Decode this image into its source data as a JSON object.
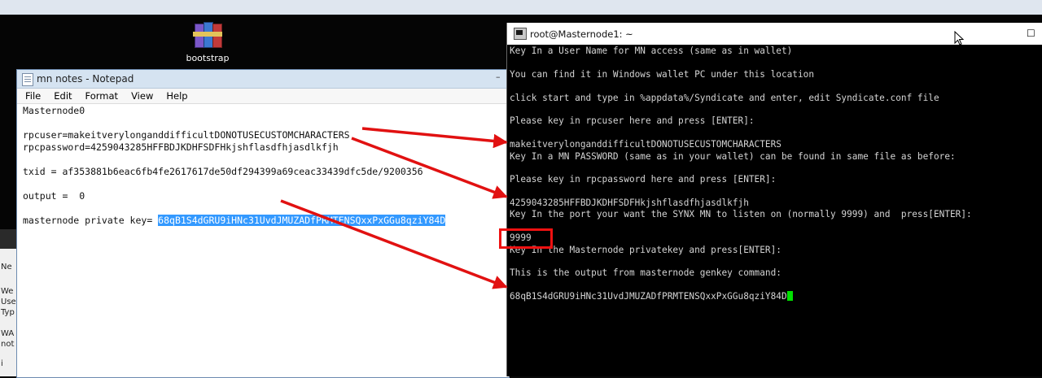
{
  "desktop": {
    "icon_label": "bootstrap"
  },
  "bg_window": {
    "lines": [
      "Ne",
      "We",
      "Use",
      "Typ",
      "WA",
      "not",
      "i"
    ]
  },
  "notepad": {
    "title": "mn notes - Notepad",
    "minimize_symbol": "–",
    "menu": [
      "File",
      "Edit",
      "Format",
      "View",
      "Help"
    ],
    "lines": {
      "masternode": "Masternode0",
      "rpcuser": "rpcuser=makeitverylonganddifficultDONOTUSECUSTOMCHARACTERS",
      "rpcpassword": "rpcpassword=4259043285HFFBDJKDHFSDFHkjshflasdfhjasdlkfjh",
      "txid": "txid = af353881b6eac6fb4fe2617617de50df294399a69ceac33439dfc5de/9200356",
      "output": "output =  0",
      "privkey_label": "masternode private key= ",
      "privkey_value": "68qB1S4dGRU9iHNc31UvdJMUZADfPRMTENSQxxPxGGu8qziY84D"
    }
  },
  "putty": {
    "title": "root@Masternode1: ~",
    "max_symbol": "☐",
    "lines": [
      "Key In a User Name for MN access (same as in wallet)",
      "",
      "You can find it in Windows wallet PC under this location",
      "",
      "click start and type in %appdata%/Syndicate and enter, edit Syndicate.conf file",
      "",
      "Please key in rpcuser here and press [ENTER]:",
      "",
      "makeitverylonganddifficultDONOTUSECUSTOMCHARACTERS",
      "Key In a MN PASSWORD (same as in your wallet) can be found in same file as before:",
      "",
      "Please key in rpcpassword here and press [ENTER]:",
      "",
      "4259043285HFFBDJKDHFSDFHkjshflasdfhjasdlkfjh",
      "Key In the port your want the SYNX MN to listen on (normally 9999) and  press[ENTER]:",
      "",
      "9999",
      "Key In the Masternode privatekey and press[ENTER]:",
      "",
      "This is the output from masternode genkey command:",
      "",
      "68qB1S4dGRU9iHNc31UvdJMUZADfPRMTENSQxxPxGGu8qziY84D"
    ]
  },
  "colors": {
    "annotation": "#e11111",
    "selection": "#3399ff",
    "cursor": "#00e000"
  }
}
